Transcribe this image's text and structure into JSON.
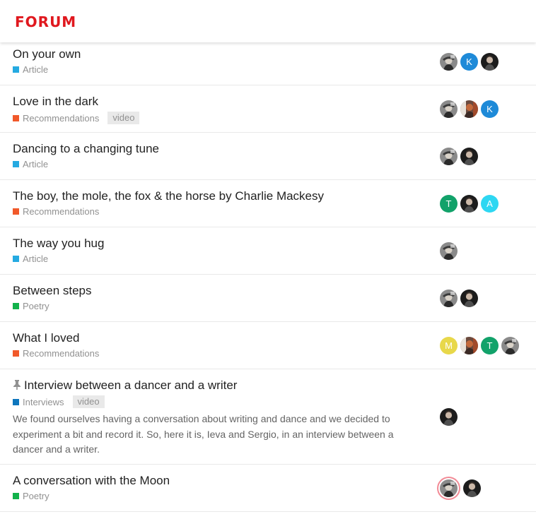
{
  "header": {
    "logo_text": "FORUM"
  },
  "category_colors": {
    "Article": "#25aae1",
    "Recommendations": "#f1592a",
    "Poetry": "#12b24b",
    "Interviews": "#0e76bd"
  },
  "topics": [
    {
      "title": "On your own",
      "category": "Article",
      "posters": [
        {
          "type": "photo-hat"
        },
        {
          "type": "letter",
          "letter": "K",
          "color": "#1e8ad8"
        },
        {
          "type": "photo-dark"
        }
      ]
    },
    {
      "title": "Love in the dark",
      "category": "Recommendations",
      "tag": "video",
      "posters": [
        {
          "type": "photo-hat"
        },
        {
          "type": "photo-red"
        },
        {
          "type": "letter",
          "letter": "K",
          "color": "#1e8ad8"
        }
      ]
    },
    {
      "title": "Dancing to a changing tune",
      "category": "Article",
      "posters": [
        {
          "type": "photo-hat"
        },
        {
          "type": "photo-dark"
        }
      ]
    },
    {
      "title": "The boy, the mole, the fox & the horse by Charlie Mackesy",
      "category": "Recommendations",
      "posters": [
        {
          "type": "letter",
          "letter": "T",
          "color": "#12a26a"
        },
        {
          "type": "photo-dark"
        },
        {
          "type": "letter",
          "letter": "A",
          "color": "#2ed7f2"
        }
      ]
    },
    {
      "title": "The way you hug",
      "category": "Article",
      "posters": [
        {
          "type": "photo-hat"
        }
      ]
    },
    {
      "title": "Between steps",
      "category": "Poetry",
      "posters": [
        {
          "type": "photo-hat"
        },
        {
          "type": "photo-dark"
        }
      ]
    },
    {
      "title": "What I loved",
      "category": "Recommendations",
      "posters": [
        {
          "type": "letter",
          "letter": "M",
          "color": "#e8d84a"
        },
        {
          "type": "photo-red"
        },
        {
          "type": "letter",
          "letter": "T",
          "color": "#12a26a"
        },
        {
          "type": "photo-hat"
        }
      ]
    },
    {
      "title": "Interview between a dancer and a writer",
      "pinned": true,
      "category": "Interviews",
      "tag": "video",
      "excerpt": "We found ourselves having a conversation about writing and dance and we decided to experiment a bit and record it. So, here it is, Ieva and Sergio, in an interview between a dancer and a writer.",
      "posters": [
        {
          "type": "photo-dark"
        }
      ]
    },
    {
      "title": "A conversation with the Moon",
      "category": "Poetry",
      "posters": [
        {
          "type": "photo-hat",
          "highlight": true
        },
        {
          "type": "photo-dark"
        }
      ]
    }
  ]
}
